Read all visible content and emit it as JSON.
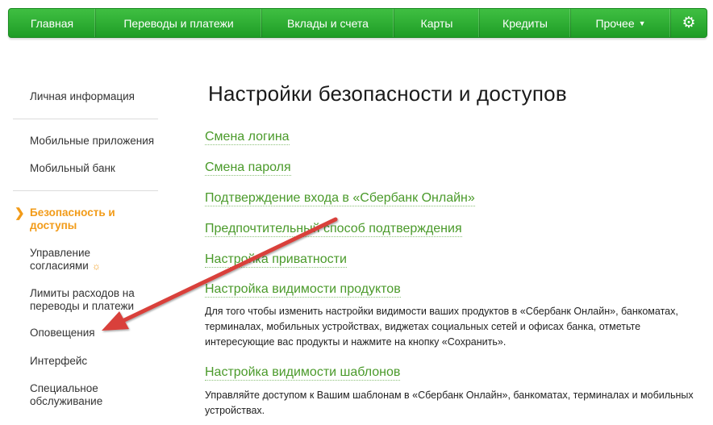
{
  "nav": {
    "items": [
      "Главная",
      "Переводы и платежи",
      "Вклады и счета",
      "Карты",
      "Кредиты",
      "Прочее"
    ],
    "settings_icon": "gear-icon"
  },
  "sidebar": {
    "personal_info": "Личная информация",
    "mobile_apps": "Мобильные приложения",
    "mobile_bank": "Мобильный банк",
    "security_line1": "Безопасность и",
    "security_line2": "доступы",
    "consent_line1": "Управление",
    "consent_line2": "согласиями",
    "limits_line1": "Лимиты расходов на",
    "limits_line2": "переводы и платежи",
    "notifications": "Оповещения",
    "interface": "Интерфейс",
    "special_line1": "Специальное",
    "special_line2": "обслуживание"
  },
  "main": {
    "title": "Настройки безопасности и доступов",
    "links": {
      "change_login": "Смена логина",
      "change_password": "Смена пароля",
      "login_confirmation": "Подтверждение входа в «Сбербанк Онлайн»",
      "preferred_confirmation": "Предпочтительный способ подтверждения",
      "privacy": "Настройка приватности",
      "products_visibility": "Настройка видимости продуктов",
      "templates_visibility": "Настройка видимости шаблонов"
    },
    "products_desc_line1": "Для того чтобы изменить настройки видимости ваших продуктов в «Сбербанк Онлайн», банкоматах,",
    "products_desc_line2": "терминалах, мобильных устройствах, виджетах социальных сетей и офисах банка, отметьте",
    "products_desc_line3": "интересующие вас продукты и нажмите на кнопку «Сохранить».",
    "templates_desc_line1": "Управляйте доступом к Вашим шаблонам в «Сбербанк Онлайн», банкоматах, терминалах и мобильных",
    "templates_desc_line2": "устройствах."
  },
  "colors": {
    "nav_green": "#2aa832",
    "link_green": "#4a9a2a",
    "active_orange": "#f29b18",
    "arrow_red": "#d9403a"
  }
}
